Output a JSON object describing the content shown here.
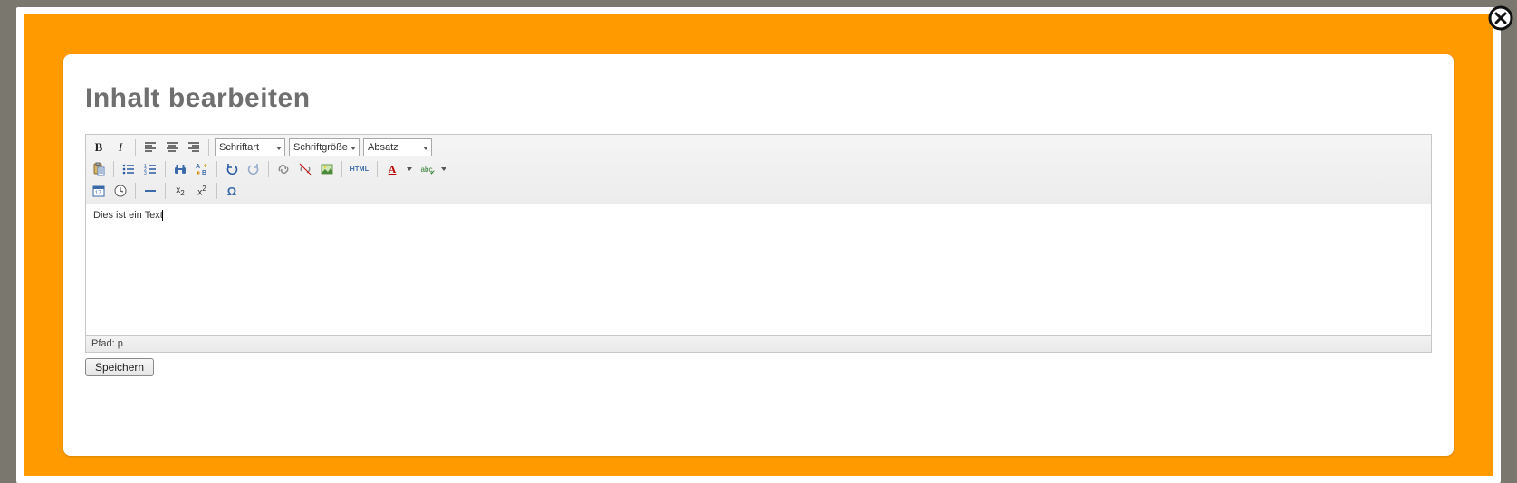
{
  "title": "Inhalt bearbeiten",
  "toolbar": {
    "font_family_label": "Schriftart",
    "font_size_label": "Schriftgröße",
    "format_label": "Absatz",
    "html_label": "HTML",
    "text_color_letter": "A",
    "spellcheck_label": "abc",
    "sub_label": "x",
    "sup_label": "x",
    "omega": "Ω"
  },
  "content": {
    "text": "Dies ist ein Text"
  },
  "statusbar": {
    "path": "Pfad: p"
  },
  "actions": {
    "save_label": "Speichern"
  }
}
